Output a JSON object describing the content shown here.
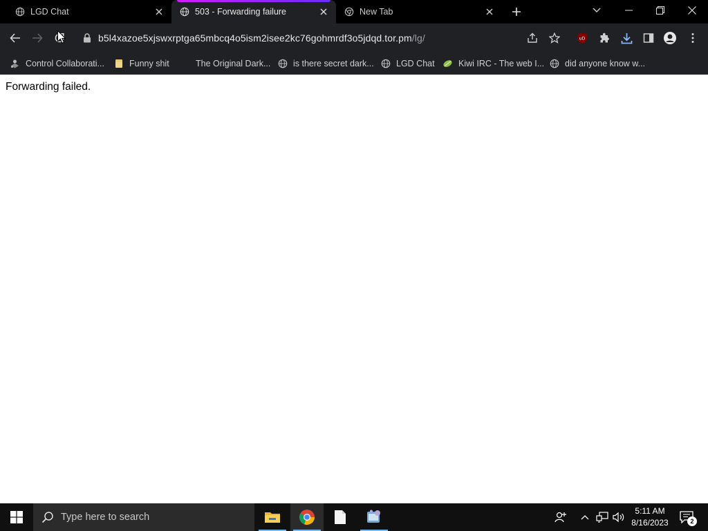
{
  "tabs": [
    {
      "title": "LGD Chat",
      "active": false
    },
    {
      "title": "503 - Forwarding failure",
      "active": true
    },
    {
      "title": "New Tab",
      "active": false
    }
  ],
  "address_bar": {
    "host": "b5l4xazoe5xjswxrptga65mbcq4o5ism2isee2kc76gohmrdf3o5jdqd.tor.pm",
    "path": "/lg/"
  },
  "bookmarks": [
    {
      "label": "Control Collaborati...",
      "icon": "bookmark-app-icon"
    },
    {
      "label": "Funny shit",
      "icon": "folder-icon"
    },
    {
      "label": "The Original Dark...",
      "icon": "blank-icon"
    },
    {
      "label": "is there secret dark...",
      "icon": "globe-icon"
    },
    {
      "label": "LGD Chat",
      "icon": "globe-icon"
    },
    {
      "label": "Kiwi IRC - The web I...",
      "icon": "kiwi-icon"
    },
    {
      "label": "did anyone know w...",
      "icon": "globe-icon"
    }
  ],
  "page": {
    "message": "Forwarding failed."
  },
  "taskbar": {
    "search_placeholder": "Type here to search",
    "time": "5:11 AM",
    "date": "8/16/2023",
    "notification_count": "2"
  },
  "colors": {
    "tab_accent": "#c21cff",
    "chrome_dark": "#202124",
    "taskbar": "#101010"
  }
}
